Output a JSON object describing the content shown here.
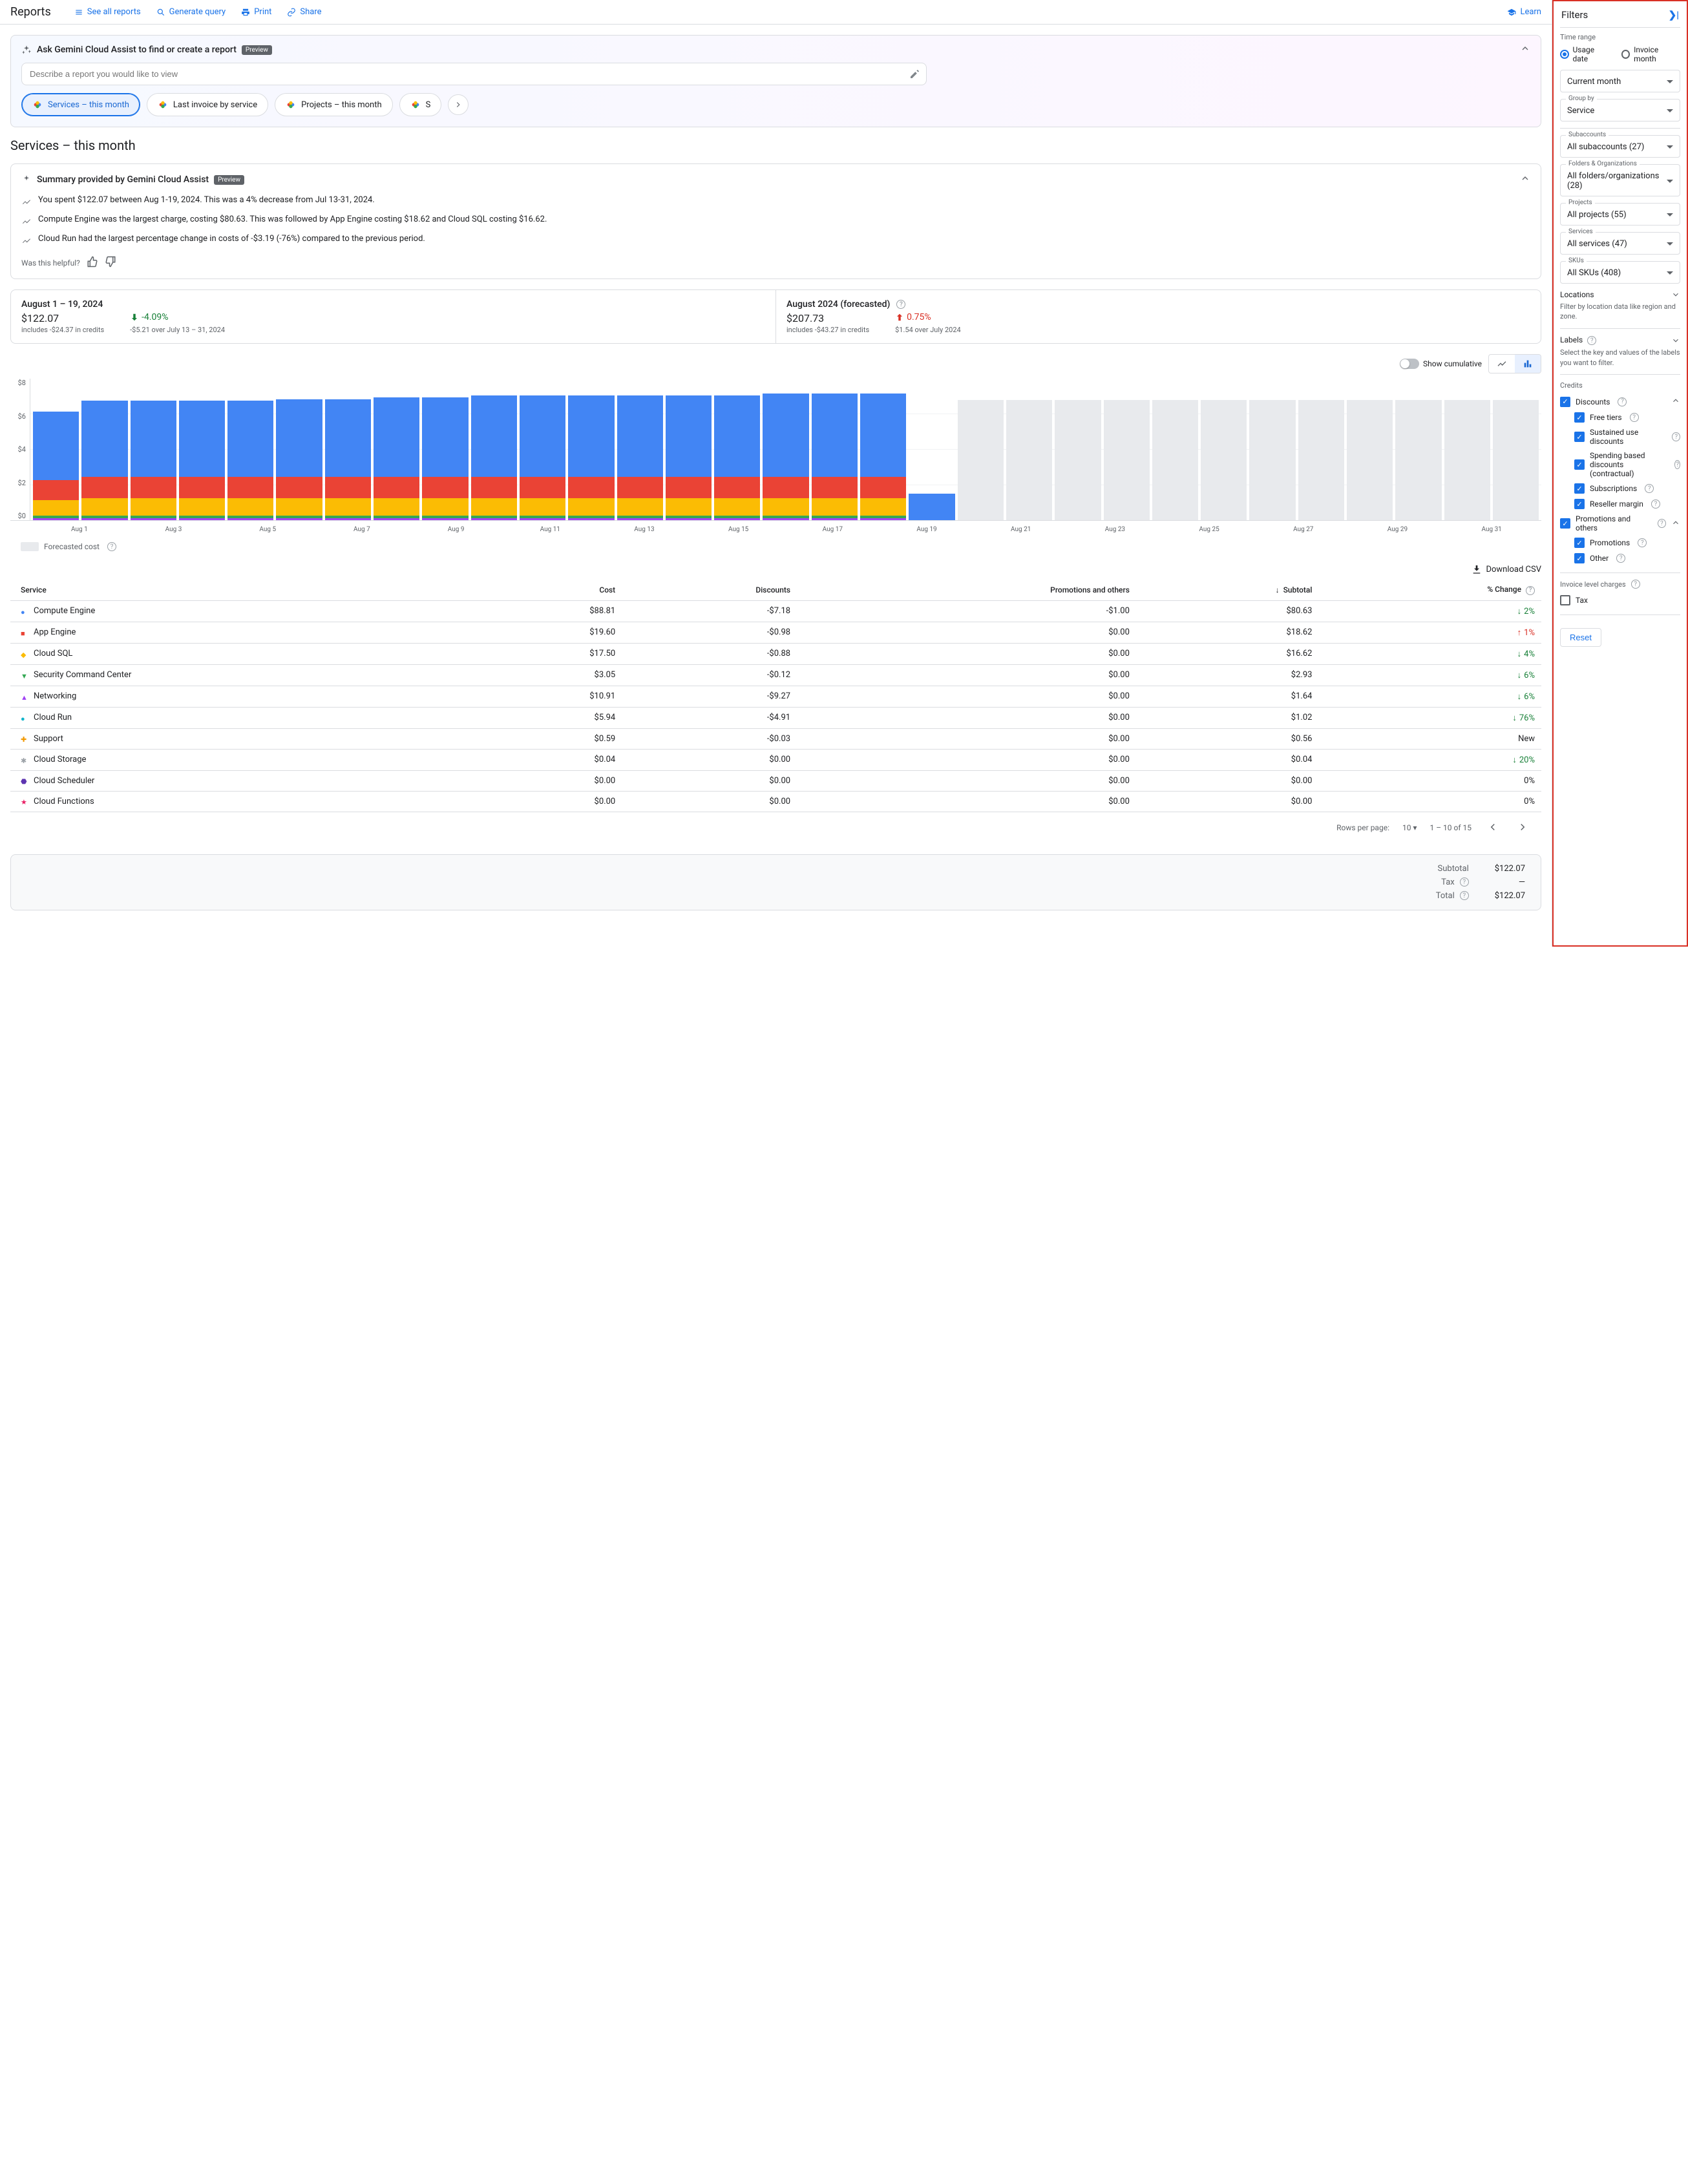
{
  "top": {
    "title": "Reports",
    "see_all": "See all reports",
    "gen_query": "Generate query",
    "print": "Print",
    "share": "Share",
    "learn": "Learn"
  },
  "gemini": {
    "title": "Ask Gemini Cloud Assist to find or create a report",
    "badge": "Preview",
    "placeholder": "Describe a report you would like to view",
    "chips": [
      "Services – this month",
      "Last invoice by service",
      "Projects – this month",
      "S"
    ]
  },
  "report_title": "Services – this month",
  "summary": {
    "title": "Summary provided by Gemini Cloud Assist",
    "badge": "Preview",
    "items": [
      "You spent $122.07 between Aug 1-19, 2024. This was a 4% decrease from Jul 13-31, 2024.",
      "Compute Engine was the largest charge, costing $80.63. This was followed by App Engine costing $18.62 and Cloud SQL costing $16.62.",
      "Cloud Run had the largest percentage change in costs of -$3.19 (-76%) compared to the previous period."
    ],
    "helpful": "Was this helpful?"
  },
  "stats": {
    "left": {
      "range": "August 1 – 19, 2024",
      "amount": "$122.07",
      "sub": "includes -$24.37 in credits",
      "change": "-4.09%",
      "change_sub": "-$5.21 over July 13 – 31, 2024",
      "dir": "down"
    },
    "right": {
      "range": "August 2024 (forecasted)",
      "amount": "$207.73",
      "sub": "includes -$43.27 in credits",
      "change": "0.75%",
      "change_sub": "$1.54 over July 2024",
      "dir": "up"
    }
  },
  "chart_toolbar": {
    "cumulative": "Show cumulative"
  },
  "chart_data": {
    "type": "bar",
    "ylabel": "$",
    "ylim": [
      0,
      8
    ],
    "y_ticks": [
      "$0",
      "$2",
      "$4",
      "$6",
      "$8"
    ],
    "categories": [
      "Aug 1",
      "Aug 3",
      "Aug 5",
      "Aug 7",
      "Aug 9",
      "Aug 11",
      "Aug 13",
      "Aug 15",
      "Aug 17",
      "Aug 19",
      "Aug 21",
      "Aug 23",
      "Aug 25",
      "Aug 27",
      "Aug 29",
      "Aug 31"
    ],
    "forecast_label": "Forecasted cost",
    "days": [
      {
        "actual": [
          {
            "c": "#4285f4",
            "v": 3.9
          },
          {
            "c": "#ea4335",
            "v": 1.1
          },
          {
            "c": "#fbbc04",
            "v": 0.9
          },
          {
            "c": "#34a853",
            "v": 0.15
          },
          {
            "c": "#a142f4",
            "v": 0.1
          }
        ]
      },
      {
        "actual": [
          {
            "c": "#4285f4",
            "v": 4.3
          },
          {
            "c": "#ea4335",
            "v": 1.2
          },
          {
            "c": "#fbbc04",
            "v": 1.0
          },
          {
            "c": "#34a853",
            "v": 0.15
          },
          {
            "c": "#a142f4",
            "v": 0.1
          }
        ]
      },
      {
        "actual": [
          {
            "c": "#4285f4",
            "v": 4.3
          },
          {
            "c": "#ea4335",
            "v": 1.2
          },
          {
            "c": "#fbbc04",
            "v": 1.0
          },
          {
            "c": "#34a853",
            "v": 0.15
          },
          {
            "c": "#a142f4",
            "v": 0.1
          }
        ]
      },
      {
        "actual": [
          {
            "c": "#4285f4",
            "v": 4.3
          },
          {
            "c": "#ea4335",
            "v": 1.2
          },
          {
            "c": "#fbbc04",
            "v": 1.0
          },
          {
            "c": "#34a853",
            "v": 0.15
          },
          {
            "c": "#a142f4",
            "v": 0.1
          }
        ]
      },
      {
        "actual": [
          {
            "c": "#4285f4",
            "v": 4.3
          },
          {
            "c": "#ea4335",
            "v": 1.2
          },
          {
            "c": "#fbbc04",
            "v": 1.0
          },
          {
            "c": "#34a853",
            "v": 0.15
          },
          {
            "c": "#a142f4",
            "v": 0.1
          }
        ]
      },
      {
        "actual": [
          {
            "c": "#4285f4",
            "v": 4.4
          },
          {
            "c": "#ea4335",
            "v": 1.2
          },
          {
            "c": "#fbbc04",
            "v": 1.0
          },
          {
            "c": "#34a853",
            "v": 0.15
          },
          {
            "c": "#a142f4",
            "v": 0.1
          }
        ]
      },
      {
        "actual": [
          {
            "c": "#4285f4",
            "v": 4.4
          },
          {
            "c": "#ea4335",
            "v": 1.2
          },
          {
            "c": "#fbbc04",
            "v": 1.0
          },
          {
            "c": "#34a853",
            "v": 0.15
          },
          {
            "c": "#a142f4",
            "v": 0.1
          }
        ]
      },
      {
        "actual": [
          {
            "c": "#4285f4",
            "v": 4.5
          },
          {
            "c": "#ea4335",
            "v": 1.2
          },
          {
            "c": "#fbbc04",
            "v": 1.0
          },
          {
            "c": "#34a853",
            "v": 0.15
          },
          {
            "c": "#a142f4",
            "v": 0.1
          }
        ]
      },
      {
        "actual": [
          {
            "c": "#4285f4",
            "v": 4.5
          },
          {
            "c": "#ea4335",
            "v": 1.2
          },
          {
            "c": "#fbbc04",
            "v": 1.0
          },
          {
            "c": "#34a853",
            "v": 0.15
          },
          {
            "c": "#a142f4",
            "v": 0.1
          }
        ]
      },
      {
        "actual": [
          {
            "c": "#4285f4",
            "v": 4.6
          },
          {
            "c": "#ea4335",
            "v": 1.2
          },
          {
            "c": "#fbbc04",
            "v": 1.0
          },
          {
            "c": "#34a853",
            "v": 0.15
          },
          {
            "c": "#a142f4",
            "v": 0.1
          }
        ]
      },
      {
        "actual": [
          {
            "c": "#4285f4",
            "v": 4.6
          },
          {
            "c": "#ea4335",
            "v": 1.2
          },
          {
            "c": "#fbbc04",
            "v": 1.0
          },
          {
            "c": "#34a853",
            "v": 0.15
          },
          {
            "c": "#a142f4",
            "v": 0.1
          }
        ]
      },
      {
        "actual": [
          {
            "c": "#4285f4",
            "v": 4.6
          },
          {
            "c": "#ea4335",
            "v": 1.2
          },
          {
            "c": "#fbbc04",
            "v": 1.0
          },
          {
            "c": "#34a853",
            "v": 0.15
          },
          {
            "c": "#a142f4",
            "v": 0.1
          }
        ]
      },
      {
        "actual": [
          {
            "c": "#4285f4",
            "v": 4.6
          },
          {
            "c": "#ea4335",
            "v": 1.2
          },
          {
            "c": "#fbbc04",
            "v": 1.0
          },
          {
            "c": "#34a853",
            "v": 0.15
          },
          {
            "c": "#a142f4",
            "v": 0.1
          }
        ]
      },
      {
        "actual": [
          {
            "c": "#4285f4",
            "v": 4.6
          },
          {
            "c": "#ea4335",
            "v": 1.2
          },
          {
            "c": "#fbbc04",
            "v": 1.0
          },
          {
            "c": "#34a853",
            "v": 0.15
          },
          {
            "c": "#a142f4",
            "v": 0.1
          }
        ]
      },
      {
        "actual": [
          {
            "c": "#4285f4",
            "v": 4.6
          },
          {
            "c": "#ea4335",
            "v": 1.2
          },
          {
            "c": "#fbbc04",
            "v": 1.0
          },
          {
            "c": "#34a853",
            "v": 0.15
          },
          {
            "c": "#a142f4",
            "v": 0.1
          }
        ]
      },
      {
        "actual": [
          {
            "c": "#4285f4",
            "v": 4.7
          },
          {
            "c": "#ea4335",
            "v": 1.2
          },
          {
            "c": "#fbbc04",
            "v": 1.0
          },
          {
            "c": "#34a853",
            "v": 0.15
          },
          {
            "c": "#a142f4",
            "v": 0.1
          }
        ]
      },
      {
        "actual": [
          {
            "c": "#4285f4",
            "v": 4.7
          },
          {
            "c": "#ea4335",
            "v": 1.2
          },
          {
            "c": "#fbbc04",
            "v": 1.0
          },
          {
            "c": "#34a853",
            "v": 0.15
          },
          {
            "c": "#a142f4",
            "v": 0.1
          }
        ]
      },
      {
        "actual": [
          {
            "c": "#4285f4",
            "v": 4.7
          },
          {
            "c": "#ea4335",
            "v": 1.2
          },
          {
            "c": "#fbbc04",
            "v": 1.0
          },
          {
            "c": "#34a853",
            "v": 0.15
          },
          {
            "c": "#a142f4",
            "v": 0.1
          }
        ]
      },
      {
        "actual": [
          {
            "c": "#4285f4",
            "v": 1.5
          }
        ]
      },
      {
        "forecast": 6.8
      },
      {
        "forecast": 6.8
      },
      {
        "forecast": 6.8
      },
      {
        "forecast": 6.8
      },
      {
        "forecast": 6.8
      },
      {
        "forecast": 6.8
      },
      {
        "forecast": 6.8
      },
      {
        "forecast": 6.8
      },
      {
        "forecast": 6.8
      },
      {
        "forecast": 6.8
      },
      {
        "forecast": 6.8
      },
      {
        "forecast": 6.8
      }
    ]
  },
  "csv": "Download CSV",
  "table": {
    "headers": [
      "Service",
      "Cost",
      "Discounts",
      "Promotions and others",
      "Subtotal",
      "% Change"
    ],
    "sort_col": 4,
    "rows": [
      {
        "m": "●",
        "mc": "#4285f4",
        "svc": "Compute Engine",
        "cost": "$88.81",
        "disc": "-$7.18",
        "promo": "-$1.00",
        "sub": "$80.63",
        "chg": "2%",
        "dir": "down"
      },
      {
        "m": "■",
        "mc": "#ea4335",
        "svc": "App Engine",
        "cost": "$19.60",
        "disc": "-$0.98",
        "promo": "$0.00",
        "sub": "$18.62",
        "chg": "1%",
        "dir": "up"
      },
      {
        "m": "◆",
        "mc": "#fbbc04",
        "svc": "Cloud SQL",
        "cost": "$17.50",
        "disc": "-$0.88",
        "promo": "$0.00",
        "sub": "$16.62",
        "chg": "4%",
        "dir": "down"
      },
      {
        "m": "▼",
        "mc": "#34a853",
        "svc": "Security Command Center",
        "cost": "$3.05",
        "disc": "-$0.12",
        "promo": "$0.00",
        "sub": "$2.93",
        "chg": "6%",
        "dir": "down"
      },
      {
        "m": "▲",
        "mc": "#a142f4",
        "svc": "Networking",
        "cost": "$10.91",
        "disc": "-$9.27",
        "promo": "$0.00",
        "sub": "$1.64",
        "chg": "6%",
        "dir": "down"
      },
      {
        "m": "●",
        "mc": "#12b5cb",
        "svc": "Cloud Run",
        "cost": "$5.94",
        "disc": "-$4.91",
        "promo": "$0.00",
        "sub": "$1.02",
        "chg": "76%",
        "dir": "down"
      },
      {
        "m": "✚",
        "mc": "#f29900",
        "svc": "Support",
        "cost": "$0.59",
        "disc": "-$0.03",
        "promo": "$0.00",
        "sub": "$0.56",
        "chg": "New",
        "dir": "none"
      },
      {
        "m": "✱",
        "mc": "#9aa0a6",
        "svc": "Cloud Storage",
        "cost": "$0.04",
        "disc": "$0.00",
        "promo": "$0.00",
        "sub": "$0.04",
        "chg": "20%",
        "dir": "down"
      },
      {
        "m": "⬣",
        "mc": "#5e35b1",
        "svc": "Cloud Scheduler",
        "cost": "$0.00",
        "disc": "$0.00",
        "promo": "$0.00",
        "sub": "$0.00",
        "chg": "0%",
        "dir": "none"
      },
      {
        "m": "★",
        "mc": "#e91e63",
        "svc": "Cloud Functions",
        "cost": "$0.00",
        "disc": "$0.00",
        "promo": "$0.00",
        "sub": "$0.00",
        "chg": "0%",
        "dir": "none"
      }
    ],
    "pager": {
      "rpp_label": "Rows per page:",
      "rpp_value": "10",
      "range": "1 – 10 of 15"
    }
  },
  "totals": {
    "subtotal_label": "Subtotal",
    "subtotal": "$122.07",
    "tax_label": "Tax",
    "tax": "—",
    "total_label": "Total",
    "total": "$122.07"
  },
  "filters": {
    "title": "Filters",
    "time_range_label": "Time range",
    "radio_usage": "Usage date",
    "radio_invoice": "Invoice month",
    "current_month": "Current month",
    "group_by_label": "Group by",
    "group_by_value": "Service",
    "subaccounts_label": "Subaccounts",
    "subaccounts_value": "All subaccounts (27)",
    "folders_label": "Folders & Organizations",
    "folders_value": "All folders/organizations (28)",
    "projects_label": "Projects",
    "projects_value": "All projects (55)",
    "services_label": "Services",
    "services_value": "All services (47)",
    "skus_label": "SKUs",
    "skus_value": "All SKUs (408)",
    "locations_label": "Locations",
    "locations_help": "Filter by location data like region and zone.",
    "labels_label": "Labels",
    "labels_help": "Select the key and values of the labels you want to filter.",
    "credits_label": "Credits",
    "discounts": "Discounts",
    "free_tiers": "Free tiers",
    "sustained": "Sustained use discounts",
    "spending": "Spending based discounts (contractual)",
    "subs": "Subscriptions",
    "reseller": "Reseller margin",
    "promos": "Promotions and others",
    "promotions": "Promotions",
    "other": "Other",
    "invoice_charges": "Invoice level charges",
    "tax": "Tax",
    "reset": "Reset"
  }
}
